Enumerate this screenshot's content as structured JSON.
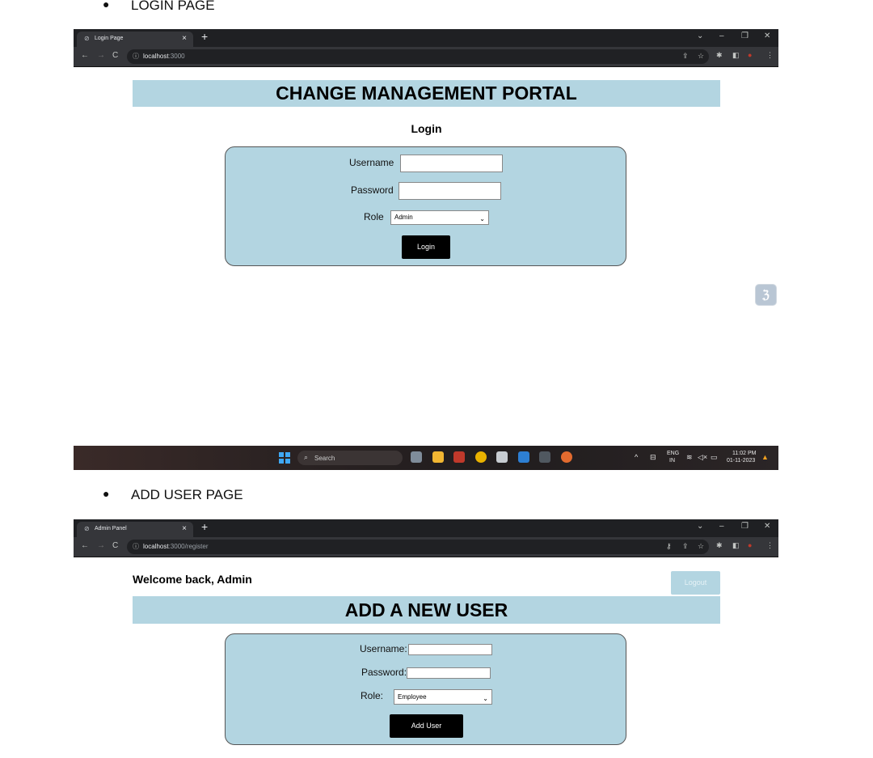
{
  "sections": {
    "login_heading": "LOGIN PAGE",
    "add_user_heading": "ADD USER PAGE"
  },
  "login_window": {
    "tab_title": "Login Page",
    "url_host": "localhost",
    "url_path": ":3000",
    "banner": "CHANGE MANAGEMENT PORTAL",
    "form_title": "Login",
    "username_label": "Username",
    "password_label": "Password",
    "role_label": "Role",
    "role_value": "Admin",
    "submit_label": "Login"
  },
  "taskbar": {
    "search_placeholder": "Search",
    "lang_top": "ENG",
    "lang_bottom": "IN",
    "time": "11:02 PM",
    "date": "01-11-2023"
  },
  "admin_window": {
    "tab_title": "Admin Panel",
    "url_host": "localhost",
    "url_path": ":3000/register",
    "welcome": "Welcome back, Admin",
    "logout_label": "Logout",
    "banner": "ADD A NEW USER",
    "username_label": "Username:",
    "password_label": "Password:",
    "role_label": "Role:",
    "role_value": "Employee",
    "submit_label": "Add User"
  },
  "colors": {
    "panel_bg": "#b3d5e1",
    "browser_dark": "#1f2023",
    "button_bg": "#000000"
  },
  "icons": [
    "globe-icon",
    "close-icon",
    "plus-icon",
    "back-icon",
    "forward-icon",
    "reload-icon",
    "info-icon",
    "share-icon",
    "star-icon",
    "extensions-icon",
    "sidepanel-icon",
    "profile-icon",
    "menu-icon",
    "key-icon",
    "windows-start-icon",
    "search-icon",
    "bell-icon",
    "wifi-icon",
    "volume-icon",
    "battery-icon"
  ]
}
